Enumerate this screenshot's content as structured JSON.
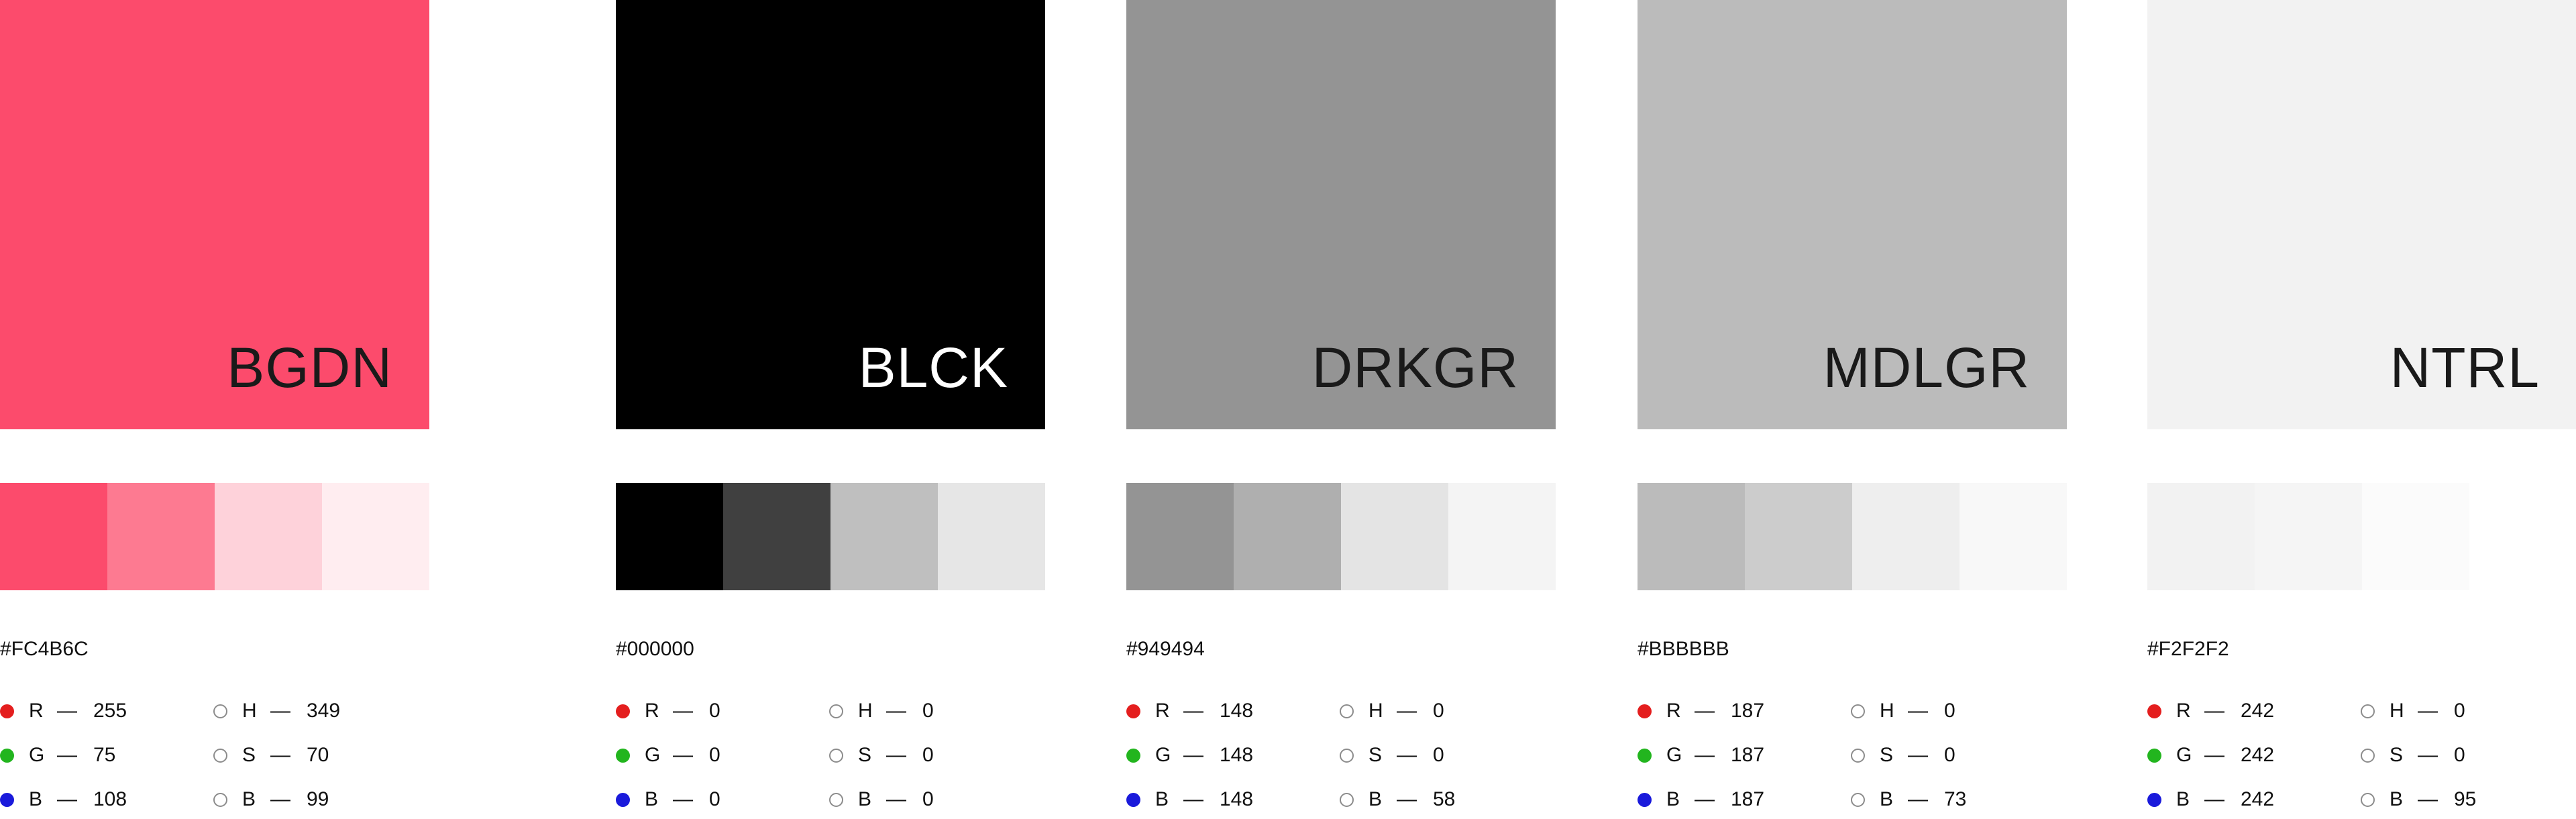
{
  "labels": {
    "dash": "—"
  },
  "colors": [
    {
      "name": "BGDN",
      "hex": "#FC4B6C",
      "swatch_color": "#FC4B6C",
      "label_color": "#1a1a1a",
      "tints": [
        "#FC4B6C",
        "#FD7A91",
        "#FED2DA",
        "#FFEDF0"
      ],
      "r": "255",
      "g": "75",
      "b_rgb": "108",
      "h": "349",
      "s": "70",
      "b_hsb": "99"
    },
    {
      "name": "BLCK",
      "hex": "#000000",
      "swatch_color": "#000000",
      "label_color": "#ffffff",
      "tints": [
        "#000000",
        "#404040",
        "#BFBFBF",
        "#E6E6E6"
      ],
      "r": "0",
      "g": "0",
      "b_rgb": "0",
      "h": "0",
      "s": "0",
      "b_hsb": "0"
    },
    {
      "name": "DRKGR",
      "hex": "#949494",
      "swatch_color": "#949494",
      "label_color": "#1a1a1a",
      "tints": [
        "#949494",
        "#AFAFAF",
        "#E4E4E4",
        "#F4F4F4"
      ],
      "r": "148",
      "g": "148",
      "b_rgb": "148",
      "h": "0",
      "s": "0",
      "b_hsb": "58"
    },
    {
      "name": "MDLGR",
      "hex": "#BBBBBB",
      "swatch_color": "#BBBBBB",
      "label_color": "#1a1a1a",
      "tints": [
        "#BBBBBB",
        "#CCCCCC",
        "#EEEEEE",
        "#F8F8F8"
      ],
      "r": "187",
      "g": "187",
      "b_rgb": "187",
      "h": "0",
      "s": "0",
      "b_hsb": "73"
    },
    {
      "name": "NTRL",
      "hex": "#F2F2F2",
      "swatch_color": "#F2F2F2",
      "label_color": "#1a1a1a",
      "tints": [
        "#F2F2F2",
        "#F5F5F5",
        "#FBFBFB",
        "#FFFFFF"
      ],
      "r": "242",
      "g": "242",
      "b_rgb": "242",
      "h": "0",
      "s": "0",
      "b_hsb": "95"
    }
  ],
  "channel_letters": {
    "r": "R",
    "g": "G",
    "b": "B",
    "h": "H",
    "s": "S"
  },
  "dot_colors": {
    "r": "#E41E1E",
    "g": "#22B51E",
    "b": "#1A1ADB"
  }
}
